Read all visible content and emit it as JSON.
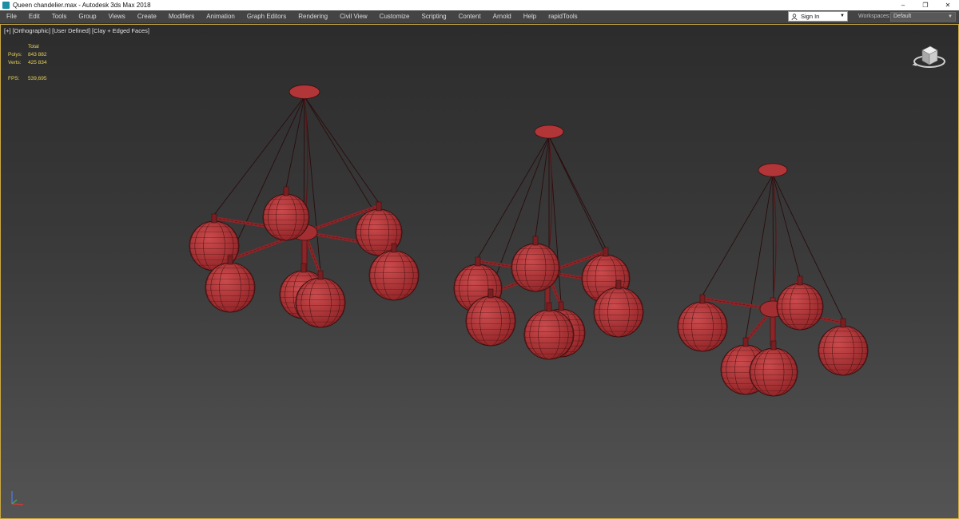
{
  "window": {
    "title": "Queen chandelier.max - Autodesk 3ds Max 2018",
    "minimize": "–",
    "restore": "❐",
    "close": "✕"
  },
  "menu": {
    "items": [
      "File",
      "Edit",
      "Tools",
      "Group",
      "Views",
      "Create",
      "Modifiers",
      "Animation",
      "Graph Editors",
      "Rendering",
      "Civil View",
      "Customize",
      "Scripting",
      "Content",
      "Arnold",
      "Help",
      "rapidTools"
    ],
    "sign_in": "Sign In",
    "workspaces_label": "Workspaces:",
    "workspace_value": "Default"
  },
  "viewport": {
    "label_plus": "[+]",
    "label_view": "[Orthographic]",
    "label_mode": "[User Defined]",
    "label_shading": "[Clay + Edged Faces]",
    "stats": {
      "header": "Total",
      "polys_label": "Polys:",
      "polys_value": "843 882",
      "verts_label": "Verts:",
      "verts_value": "425 834",
      "fps_label": "FPS:",
      "fps_value": "539,695"
    },
    "mesh_color": "#b5373a",
    "wire_color": "#3a0f10"
  },
  "icons": {
    "app": "3dsmax-app-icon",
    "viewcube": "viewcube-icon",
    "axis": "axis-tripod-icon",
    "user": "user-icon"
  }
}
